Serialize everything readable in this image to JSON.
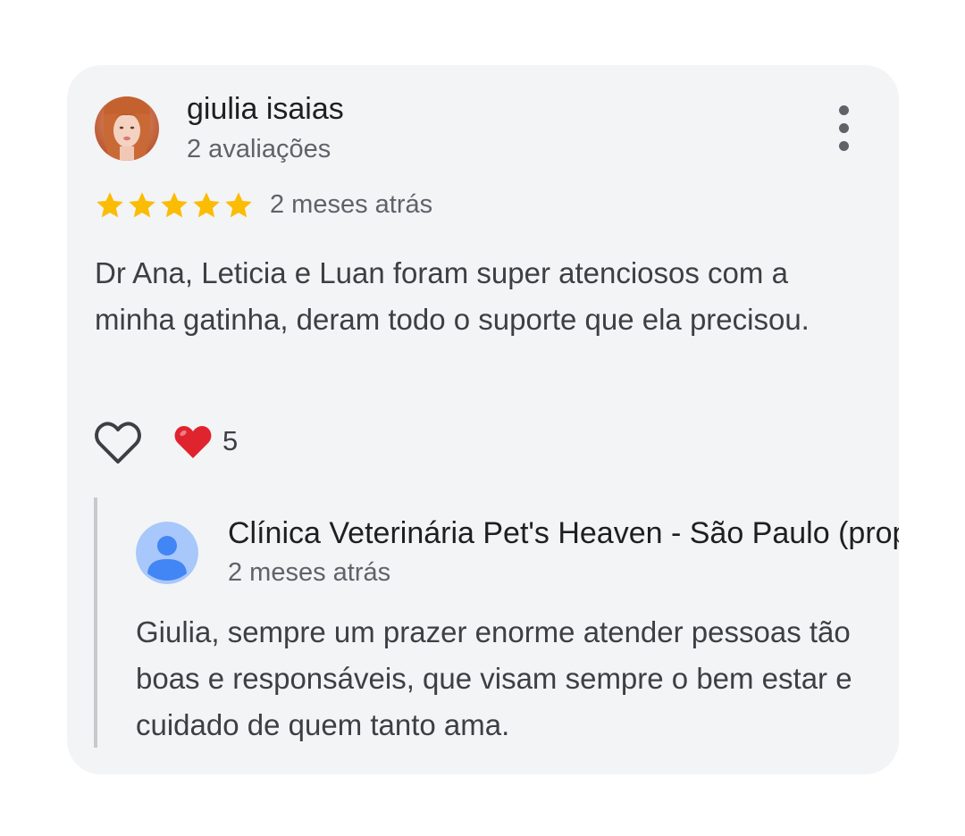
{
  "review": {
    "author_name": "giulia isaias",
    "author_meta": "2 avaliações",
    "rating": 5,
    "rating_max": 5,
    "date": "2 meses atrás",
    "text": "Dr Ana, Leticia e Luan foram super atenciosos com a minha gatinha, deram todo o suporte que ela precisou.",
    "reaction_count": "5"
  },
  "reply": {
    "owner_name": "Clínica Veterinária Pet's Heaven - São Paulo (proprietário)",
    "date": "2 meses atrás",
    "text": "Giulia, sempre um prazer enorme atender pessoas tão boas e responsáveis, que visam sempre o bem estar e cuidado de quem tanto ama."
  },
  "icons": {
    "more": "more-vert-icon",
    "like": "heart-outline-icon",
    "reaction": "red-heart-icon",
    "star": "star-icon",
    "owner_avatar": "person-icon"
  },
  "colors": {
    "card_bg": "#f3f4f6",
    "star": "#fbbc04",
    "heart": "#e0242e",
    "owner_avatar_bg": "#a8c7fa",
    "owner_avatar_fg": "#4285f4",
    "secondary_text": "#5f6368"
  }
}
